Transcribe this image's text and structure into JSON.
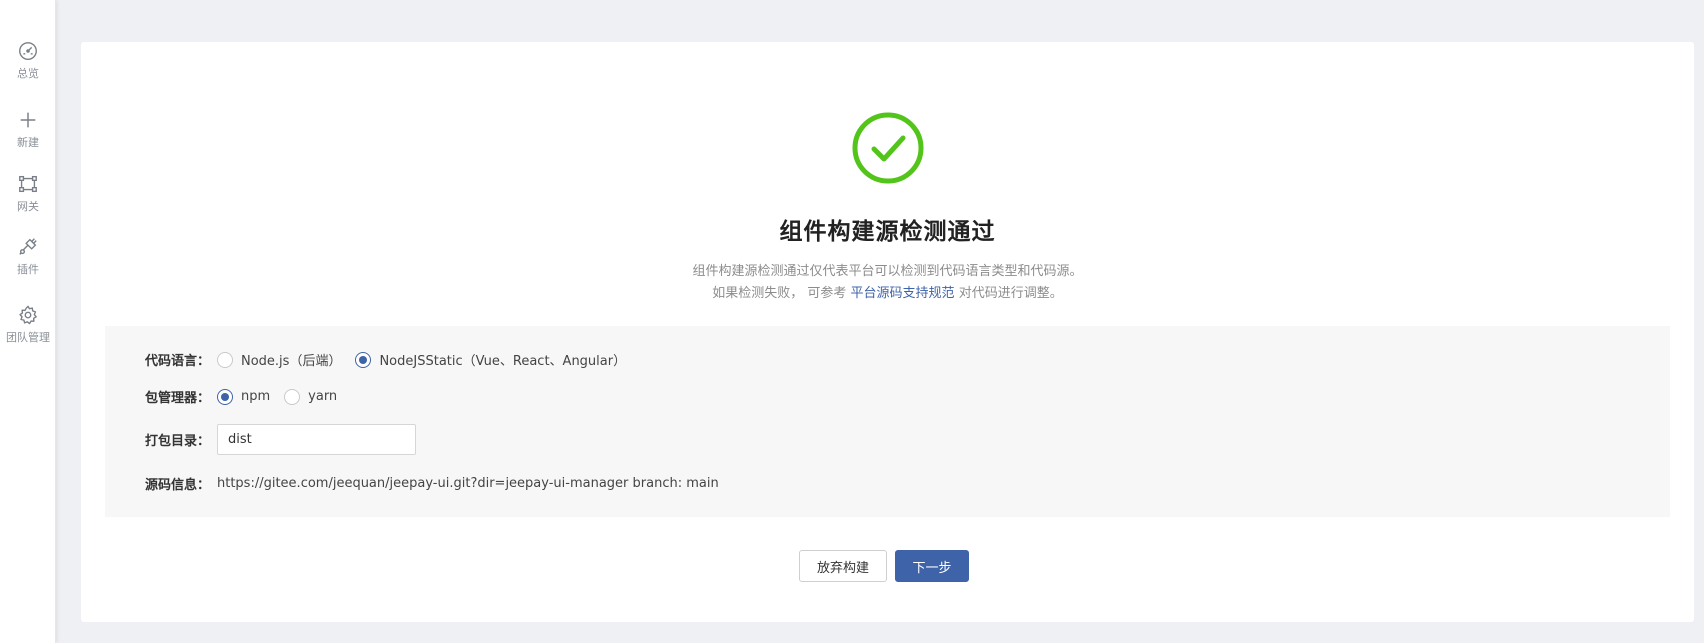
{
  "sidebar": {
    "items": [
      {
        "label": "总览",
        "icon": "dashboard-icon"
      },
      {
        "label": "新建",
        "icon": "plus-icon"
      },
      {
        "label": "网关",
        "icon": "gateway-icon"
      },
      {
        "label": "插件",
        "icon": "plug-icon"
      },
      {
        "label": "团队管理",
        "icon": "gear-icon"
      }
    ]
  },
  "result": {
    "icon": "check-circle-icon",
    "status_color": "#52c41a",
    "title": "组件构建源检测通过",
    "desc_line1": "组件构建源检测通过仅代表平台可以检测到代码语言类型和代码源。",
    "desc_line2_prefix": "如果检测失败， 可参考",
    "desc_link": "平台源码支持规范",
    "desc_line2_suffix": "对代码进行调整。"
  },
  "form": {
    "language": {
      "label": "代码语言：",
      "options": [
        "Node.js（后端）",
        "NodeJSStatic（Vue、React、Angular）"
      ],
      "selected": "NodeJSStatic（Vue、React、Angular）"
    },
    "package_manager": {
      "label": "包管理器：",
      "options": [
        "npm",
        "yarn"
      ],
      "selected": "npm"
    },
    "output_dir": {
      "label": "打包目录：",
      "value": "dist"
    },
    "source_info": {
      "label": "源码信息：",
      "value": "https://gitee.com/jeequan/jeepay-ui.git?dir=jeepay-ui-manager branch: main"
    }
  },
  "actions": {
    "cancel_label": "放弃构建",
    "next_label": "下一步",
    "accent_color": "#3f63a8"
  }
}
